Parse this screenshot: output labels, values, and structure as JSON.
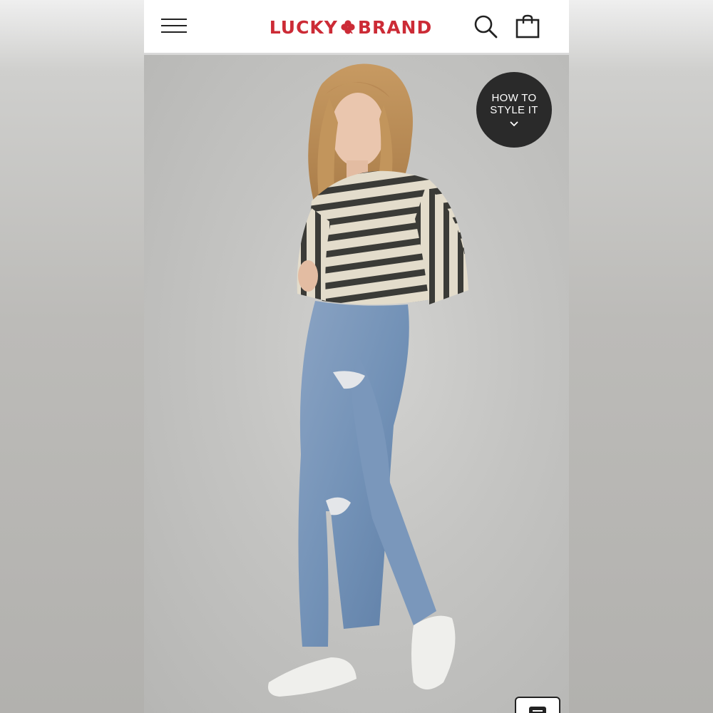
{
  "header": {
    "brand_left": "LUCKY",
    "brand_right": "BRAND",
    "brand_color": "#cc2b36",
    "menu_icon": "hamburger-menu-icon",
    "search_icon": "search-icon",
    "bag_icon": "shopping-bag-icon"
  },
  "hero": {
    "image_description_icon": "product-photo",
    "style_badge": {
      "line1": "HOW TO",
      "line2": "STYLE IT",
      "icon": "chevron-down-icon"
    }
  },
  "chat": {
    "icon": "chat-icon"
  }
}
